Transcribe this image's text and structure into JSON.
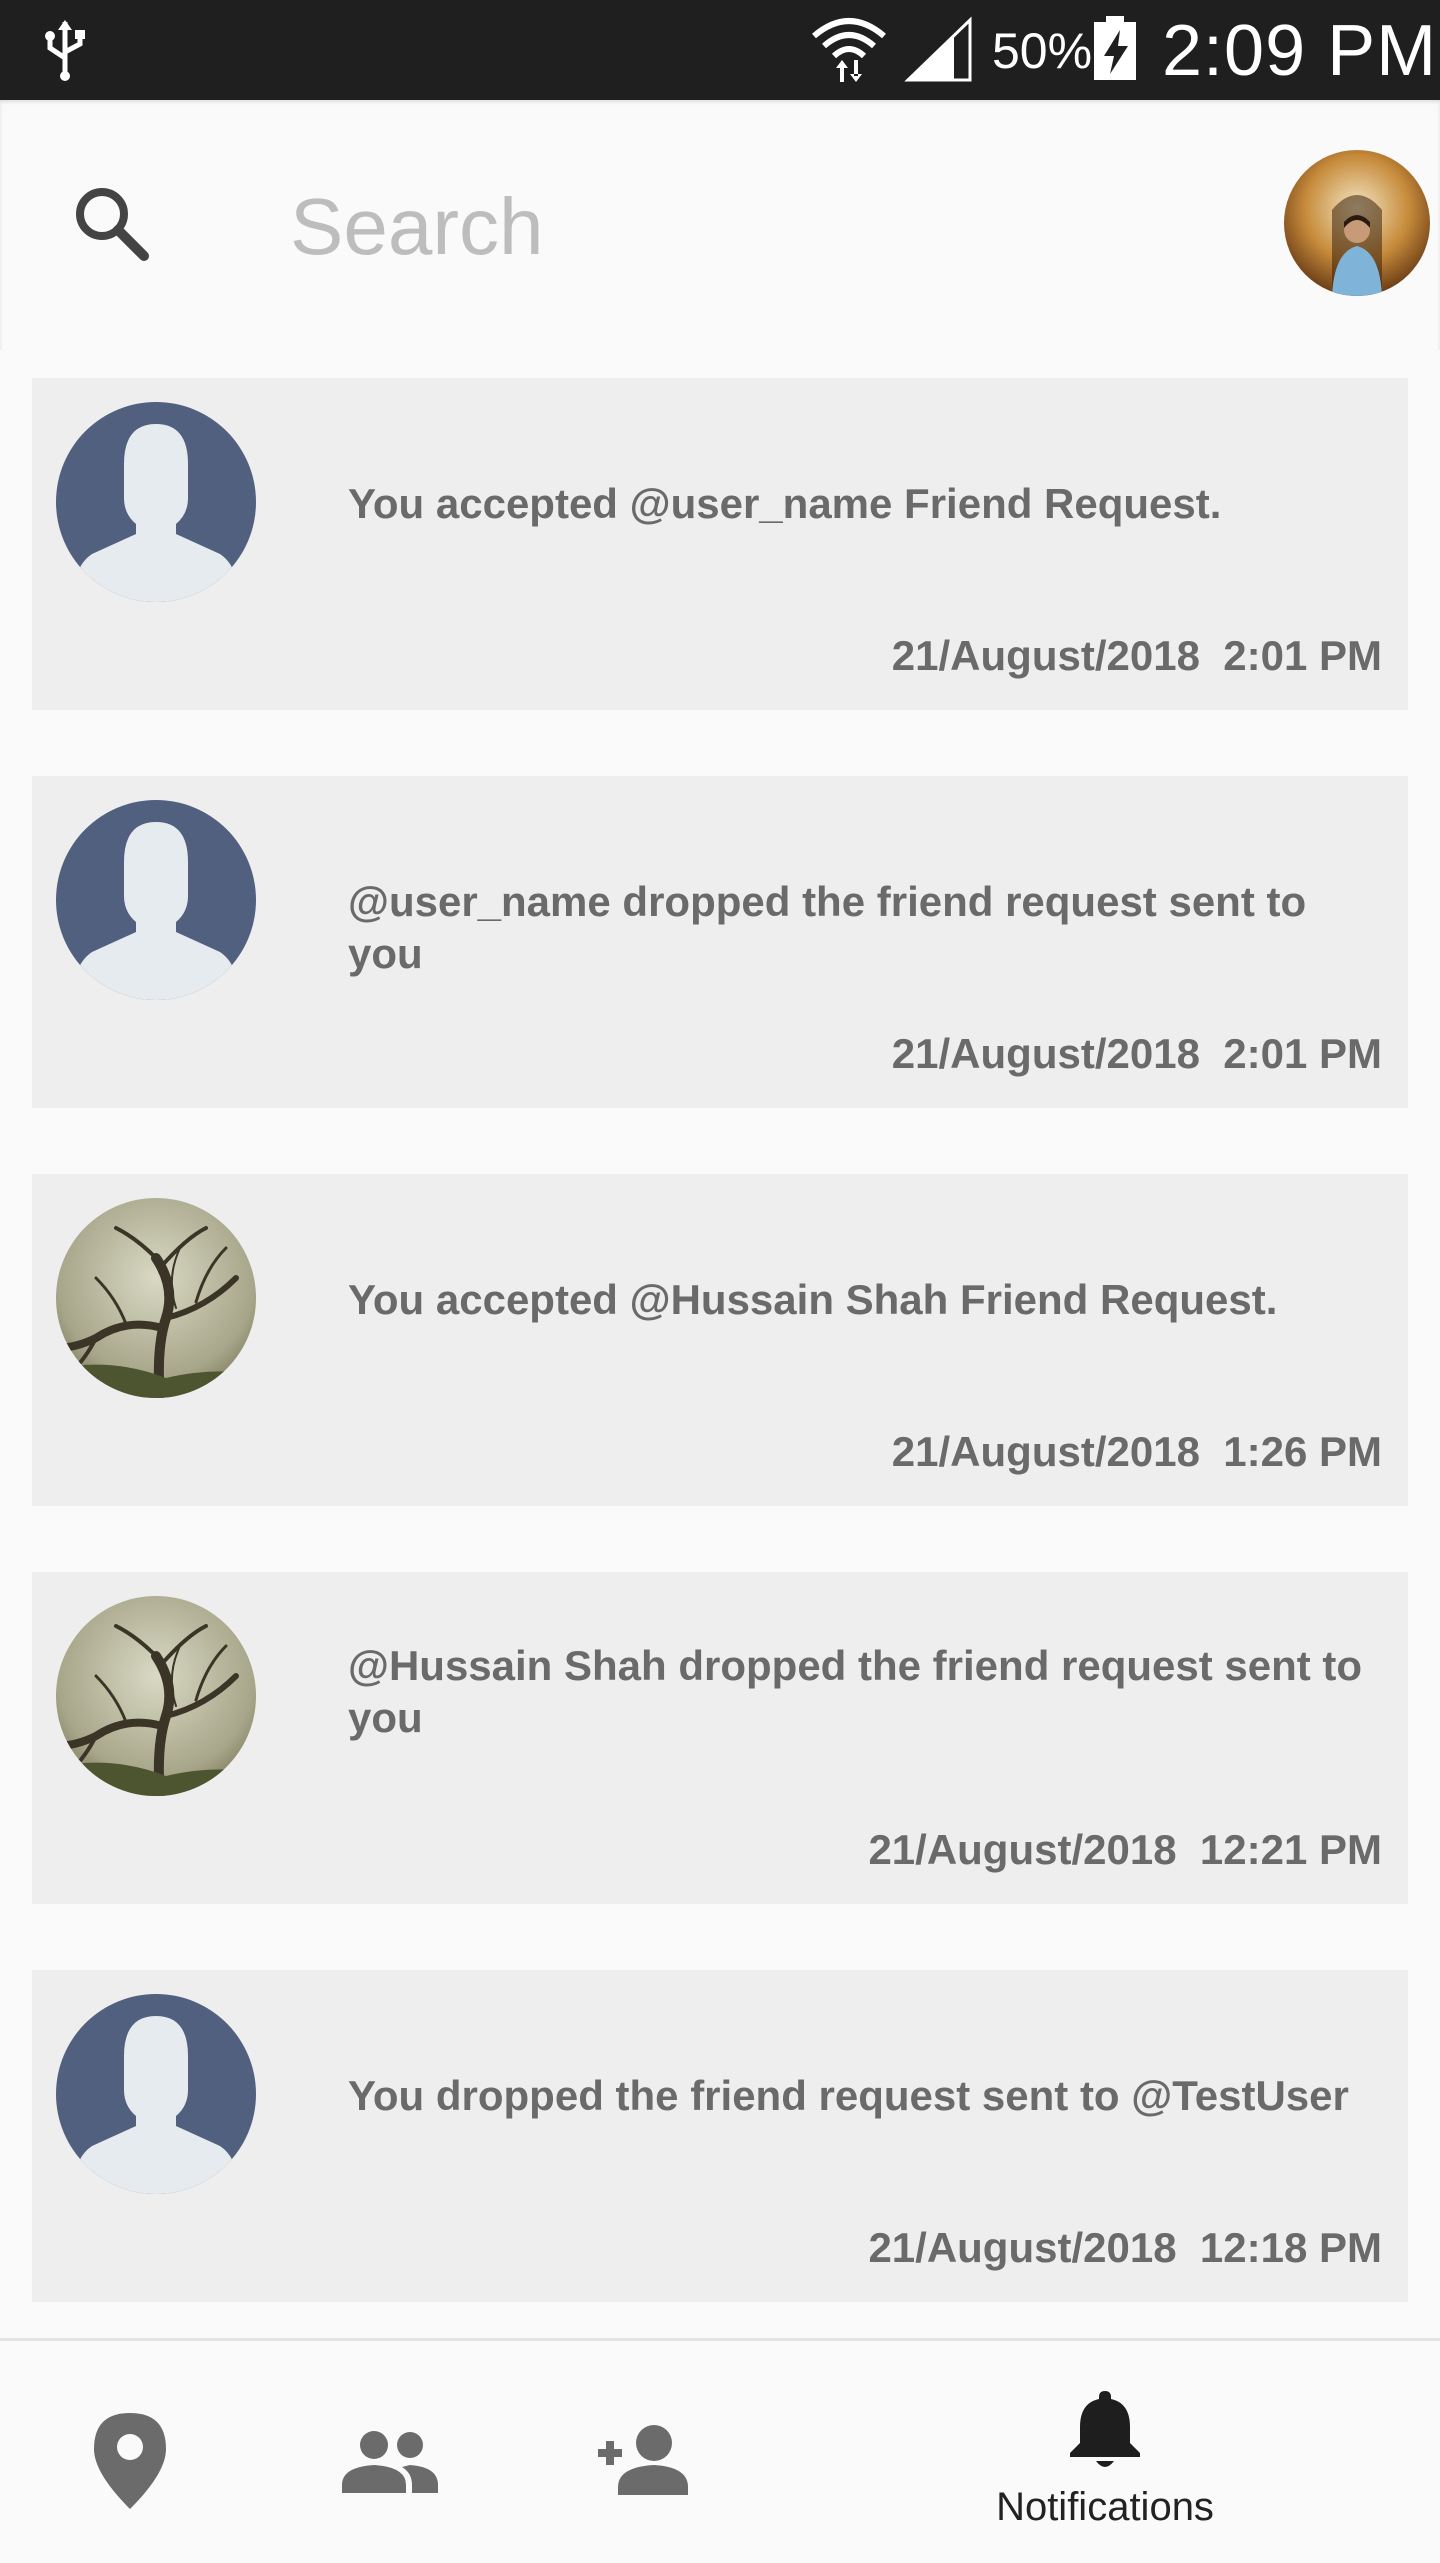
{
  "status_bar": {
    "battery_percent": "50%",
    "time": "2:09 PM"
  },
  "search": {
    "placeholder": "Search"
  },
  "notifications": [
    {
      "message": "You accepted @user_name Friend Request.",
      "timestamp": "21/August/2018  2:01 PM",
      "avatar": "default-user-avatar"
    },
    {
      "message": "@user_name dropped the friend request sent to you",
      "timestamp": "21/August/2018  2:01 PM",
      "avatar": "default-user-avatar"
    },
    {
      "message": "You accepted @Hussain Shah Friend Request.",
      "timestamp": "21/August/2018  1:26 PM",
      "avatar": "tree-photo-avatar"
    },
    {
      "message": "@Hussain Shah dropped the friend request sent to you",
      "timestamp": "21/August/2018  12:21 PM",
      "avatar": "tree-photo-avatar"
    },
    {
      "message": "You dropped the friend request sent to @TestUser",
      "timestamp": "21/August/2018  12:18 PM",
      "avatar": "default-user-avatar"
    }
  ],
  "bottom_nav": {
    "items": [
      {
        "icon": "location-pin-icon"
      },
      {
        "icon": "friends-icon"
      },
      {
        "icon": "add-friend-icon"
      },
      {
        "icon": "bell-icon",
        "label": "Notifications",
        "active": true
      }
    ]
  },
  "colors": {
    "status_bar_bg": "#1f1f1f",
    "card_bg": "#eeeeee",
    "default_avatar_bg": "#52607f",
    "text_gray": "#6a6a6a"
  }
}
